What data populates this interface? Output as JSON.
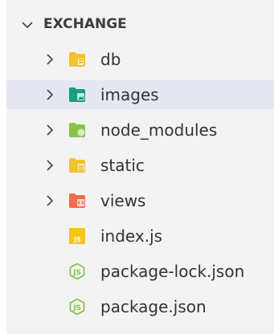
{
  "explorer": {
    "section_title": "EXCHANGE",
    "items": [
      {
        "label": "db",
        "kind": "folder",
        "icon": "folder-db-icon",
        "color": "#f2c230"
      },
      {
        "label": "images",
        "kind": "folder",
        "icon": "folder-images-icon",
        "color": "#1d9b7e"
      },
      {
        "label": "node_modules",
        "kind": "folder",
        "icon": "folder-node-icon",
        "color": "#8bc34a"
      },
      {
        "label": "static",
        "kind": "folder",
        "icon": "folder-static-icon",
        "color": "#f2c230"
      },
      {
        "label": "views",
        "kind": "folder",
        "icon": "folder-views-icon",
        "color": "#ef6c4a"
      },
      {
        "label": "index.js",
        "kind": "file",
        "icon": "js-file-icon",
        "color": "#f5c518"
      },
      {
        "label": "package-lock.json",
        "kind": "file",
        "icon": "nodejs-file-icon",
        "color": "#8bc34a"
      },
      {
        "label": "package.json",
        "kind": "file",
        "icon": "nodejs-file-icon",
        "color": "#8bc34a"
      }
    ]
  }
}
